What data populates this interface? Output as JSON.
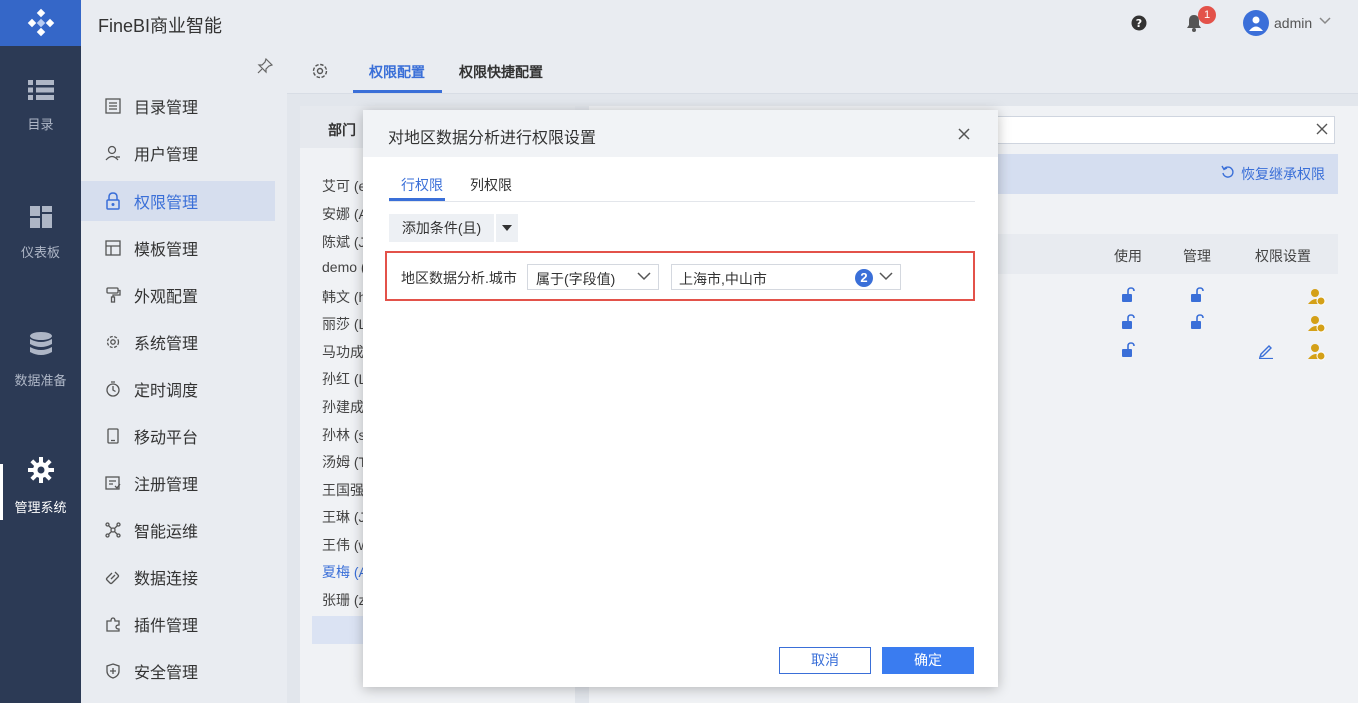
{
  "app": {
    "title": "FineBI商业智能"
  },
  "topbar": {
    "notification_count": "1",
    "username": "admin"
  },
  "rail": {
    "items": [
      {
        "label": "目录",
        "icon": "list-icon"
      },
      {
        "label": "仪表板",
        "icon": "dashboard-icon"
      },
      {
        "label": "数据准备",
        "icon": "database-icon"
      },
      {
        "label": "管理系统",
        "icon": "gear-icon",
        "active": true
      }
    ]
  },
  "sidebar": {
    "items": [
      {
        "label": "目录管理",
        "icon": "catalog-icon"
      },
      {
        "label": "用户管理",
        "icon": "user-icon"
      },
      {
        "label": "权限管理",
        "icon": "lock-icon",
        "active": true
      },
      {
        "label": "模板管理",
        "icon": "template-icon"
      },
      {
        "label": "外观配置",
        "icon": "paint-icon"
      },
      {
        "label": "系统管理",
        "icon": "settings-icon"
      },
      {
        "label": "定时调度",
        "icon": "timer-icon"
      },
      {
        "label": "移动平台",
        "icon": "mobile-icon"
      },
      {
        "label": "注册管理",
        "icon": "register-icon"
      },
      {
        "label": "智能运维",
        "icon": "ops-icon"
      },
      {
        "label": "数据连接",
        "icon": "link-icon"
      },
      {
        "label": "插件管理",
        "icon": "plugin-icon"
      },
      {
        "label": "安全管理",
        "icon": "shield-icon"
      }
    ]
  },
  "main": {
    "tabs": [
      {
        "label": "权限配置",
        "active": true
      },
      {
        "label": "权限快捷配置"
      }
    ],
    "dept": {
      "title": "部门",
      "users": [
        "艾可 (e",
        "安娜 (A",
        "陈斌 (J",
        "demo (",
        "韩文 (h",
        "丽莎 (L",
        "马功成",
        "孙红 (L",
        "孙建成",
        "孙林 (s",
        "汤姆 (T",
        "王国强",
        "王琳 (J",
        "王伟 (w",
        "夏梅 (A",
        "张珊 (z"
      ],
      "selected_index": 14
    },
    "right": {
      "restore_label": "恢复继承权限",
      "columns": [
        "使用",
        "管理",
        "权限设置"
      ]
    }
  },
  "modal": {
    "title": "对地区数据分析进行权限设置",
    "tabs": [
      {
        "label": "行权限",
        "active": true
      },
      {
        "label": "列权限"
      }
    ],
    "add_condition_label": "添加条件(且)",
    "condition": {
      "field": "地区数据分析.城市",
      "operator": "属于(字段值)",
      "value": "上海市,中山市",
      "value_count": "2"
    },
    "cancel_label": "取消",
    "ok_label": "确定"
  },
  "colors": {
    "accent": "#3a6fd8",
    "rail": "#2c3a55",
    "highlight_border": "#e3524a"
  }
}
